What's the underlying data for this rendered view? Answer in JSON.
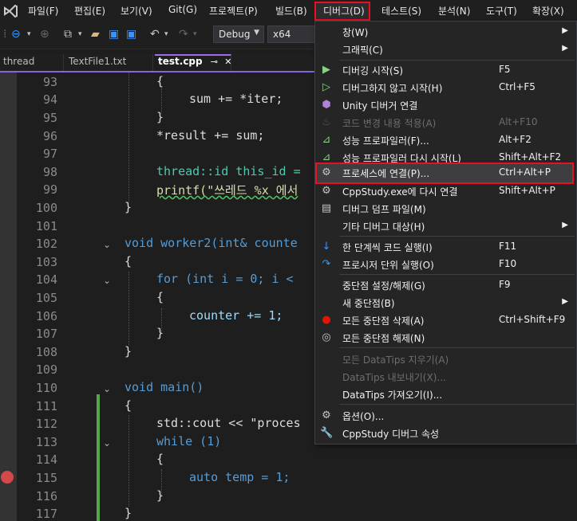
{
  "menubar": {
    "items": [
      "파일(F)",
      "편집(E)",
      "보기(V)",
      "Git(G)",
      "프로젝트(P)",
      "빌드(B)",
      "디버그(D)",
      "테스트(S)",
      "분석(N)",
      "도구(T)",
      "확장(X)"
    ]
  },
  "toolbar": {
    "config": "Debug",
    "platform": "x64"
  },
  "tabs": [
    {
      "label": "thread"
    },
    {
      "label": "TextFile1.txt"
    },
    {
      "label": "test.cpp",
      "pin": "⊸",
      "close": "✕"
    }
  ],
  "editor": {
    "line_numbers": [
      "93",
      "94",
      "95",
      "96",
      "97",
      "98",
      "99",
      "100",
      "101",
      "102",
      "103",
      "104",
      "105",
      "106",
      "107",
      "108",
      "109",
      "110",
      "111",
      "112",
      "113",
      "114",
      "115",
      "116",
      "117"
    ],
    "breakpoint_line": "115"
  },
  "code": {
    "l93": "{",
    "l94": "sum += *iter;",
    "l95": "}",
    "l96": "*result += sum;",
    "l98": "thread::id this_id =",
    "l99": "printf(\"쓰레드 %x 에서",
    "l100": "}",
    "l102": "void worker2(int& counte",
    "l103": "{",
    "l104": "for (int i = 0; i <",
    "l105": "{",
    "l106": "counter += 1;",
    "l107": "}",
    "l108": "}",
    "l110": "void main()",
    "l111": "{",
    "l112": "std::cout << \"proces",
    "l113": "while (1)",
    "l114": "{",
    "l115": "auto temp = 1;",
    "l116": "}",
    "l117": "}"
  },
  "debug_menu": {
    "items": [
      {
        "label": "창(W)",
        "shortcut": "",
        "submenu": true,
        "enabled": true
      },
      {
        "label": "그래픽(C)",
        "shortcut": "",
        "submenu": true,
        "enabled": true
      },
      {
        "label": "디버깅 시작(S)",
        "shortcut": "F5",
        "enabled": true,
        "icon": "play-icon"
      },
      {
        "label": "디버그하지 않고 시작(H)",
        "shortcut": "Ctrl+F5",
        "enabled": true,
        "icon": "play-outline-icon"
      },
      {
        "label": "Unity 디버거 연결",
        "shortcut": "",
        "enabled": true,
        "icon": "unity-cube-icon"
      },
      {
        "label": "코드 변경 내용 적용(A)",
        "shortcut": "Alt+F10",
        "enabled": false,
        "icon": "hot-reload-icon"
      },
      {
        "label": "성능 프로파일러(F)...",
        "shortcut": "Alt+F2",
        "enabled": true,
        "icon": "profiler-icon"
      },
      {
        "label": "성능 프로파일러 다시 시작(L)",
        "shortcut": "Shift+Alt+F2",
        "enabled": true,
        "icon": "profiler-restart-icon"
      },
      {
        "label": "프로세스에 연결(P)...",
        "shortcut": "Ctrl+Alt+P",
        "enabled": true,
        "icon": "attach-gear-icon"
      },
      {
        "label": "CppStudy.exe에 다시 연결",
        "shortcut": "Shift+Alt+P",
        "enabled": true,
        "icon": "reattach-gear-icon"
      },
      {
        "label": "디버그 덤프 파일(M)",
        "shortcut": "",
        "enabled": true,
        "icon": "dump-file-icon"
      },
      {
        "label": "기타 디버그 대상(H)",
        "shortcut": "",
        "submenu": true,
        "enabled": true
      },
      {
        "label": "한 단계씩 코드 실행(I)",
        "shortcut": "F11",
        "enabled": true,
        "icon": "step-into-icon"
      },
      {
        "label": "프로시저 단위 실행(O)",
        "shortcut": "F10",
        "enabled": true,
        "icon": "step-over-icon"
      },
      {
        "label": "중단점 설정/해제(G)",
        "shortcut": "F9",
        "enabled": true
      },
      {
        "label": "새 중단점(B)",
        "shortcut": "",
        "submenu": true,
        "enabled": true
      },
      {
        "label": "모든 중단점 삭제(A)",
        "shortcut": "Ctrl+Shift+F9",
        "enabled": true,
        "icon": "delete-breakpoints-icon"
      },
      {
        "label": "모든 중단점 해제(N)",
        "shortcut": "",
        "enabled": true,
        "icon": "disable-breakpoints-icon"
      },
      {
        "label": "모든 DataTips 지우기(A)",
        "shortcut": "",
        "enabled": false
      },
      {
        "label": "DataTips 내보내기(X)...",
        "shortcut": "",
        "enabled": false
      },
      {
        "label": "DataTips 가져오기(I)...",
        "shortcut": "",
        "enabled": true
      },
      {
        "label": "옵션(O)...",
        "shortcut": "",
        "enabled": true,
        "icon": "gear-icon"
      },
      {
        "label": "CppStudy 디버그 속성",
        "shortcut": "",
        "enabled": true,
        "icon": "wrench-icon"
      }
    ]
  }
}
